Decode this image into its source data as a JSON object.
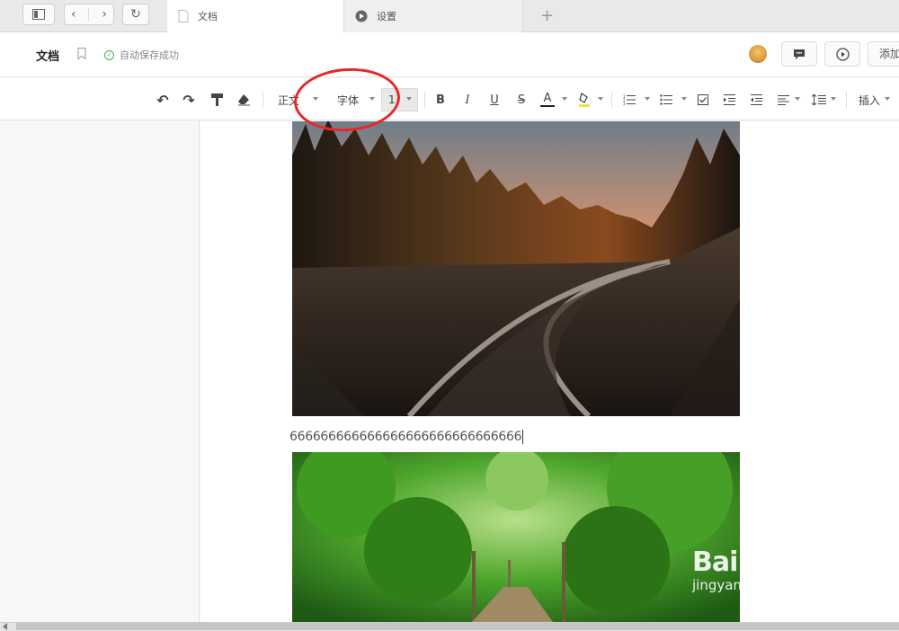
{
  "tabs": [
    {
      "label": "文档",
      "active": true
    },
    {
      "label": "设置",
      "active": false
    }
  ],
  "header": {
    "doc_title": "文档",
    "save_status": "自动保存成功",
    "add_label": "添加"
  },
  "toolbar": {
    "paragraph_style": "正文",
    "font_family": "字体",
    "font_size": "1",
    "bold": "B",
    "italic": "I",
    "underline": "U",
    "strike": "S",
    "font_color": "A",
    "insert_label": "插入"
  },
  "document": {
    "text_line": "666666666666666666666666666666"
  },
  "watermark": {
    "brand": "Bai du 经验",
    "site": "jingyan.baidu.com"
  },
  "colors": {
    "annotation_circle": "#e8262a",
    "saved_check": "#4caf50",
    "highlight": "#f4e04d"
  }
}
